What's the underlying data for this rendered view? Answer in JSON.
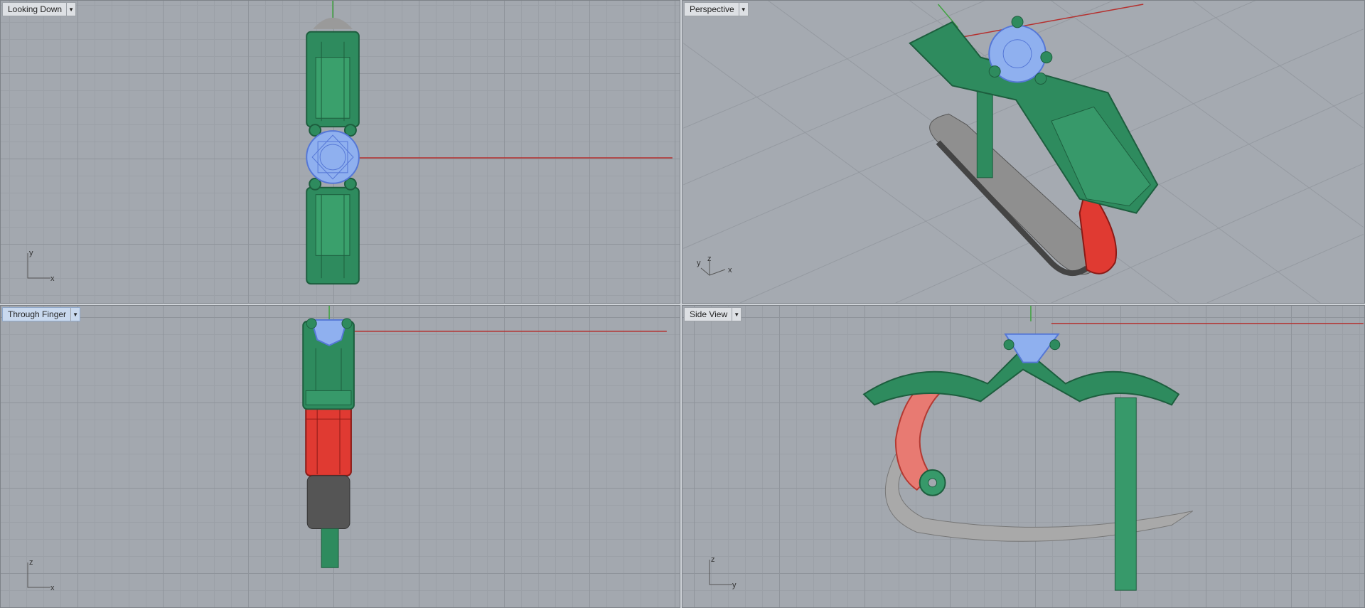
{
  "viewports": {
    "top": {
      "title": "Looking Down",
      "axis_h": "x",
      "axis_v": "y"
    },
    "perspective": {
      "title": "Perspective",
      "axis_h": "x",
      "axis_v": "y",
      "axis_z": "z"
    },
    "front": {
      "title": "Through Finger",
      "axis_h": "x",
      "axis_v": "z"
    },
    "right": {
      "title": "Side View",
      "axis_h": "y",
      "axis_v": "z"
    }
  },
  "active_viewport": "front",
  "icons": {
    "dropdown": "triangle-down-icon"
  },
  "colors": {
    "viewport_bg": "#a3a8af",
    "ring_green": "#2e8b5e",
    "gem_blue": "#8fb0ef",
    "selected_red": "#e03a32",
    "shank_gray": "#a9a9a9",
    "shank_dark": "#555555",
    "x_axis": "#b5302e",
    "y_axis": "#3fa33f"
  }
}
